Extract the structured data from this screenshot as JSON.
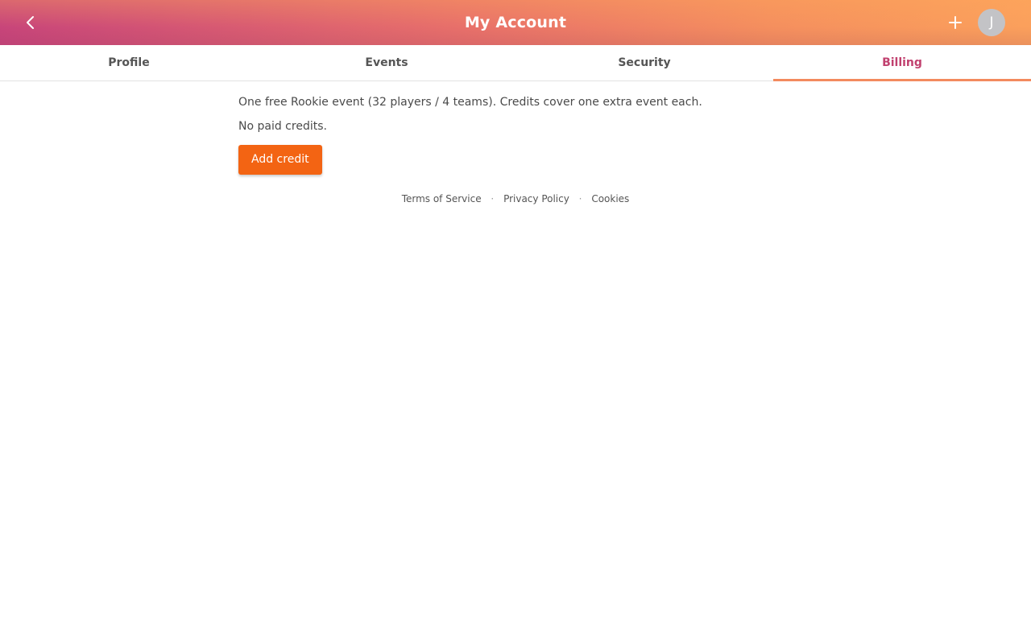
{
  "header": {
    "title": "My Account",
    "avatar_initial": "J",
    "back_icon": "chevron-left-icon",
    "add_icon": "plus-icon",
    "gradient_colors": [
      "#c8457a",
      "#e8706a",
      "#fba05c"
    ]
  },
  "tabs": [
    {
      "label": "Profile",
      "active": false
    },
    {
      "label": "Events",
      "active": false
    },
    {
      "label": "Security",
      "active": false
    },
    {
      "label": "Billing",
      "active": true
    }
  ],
  "billing": {
    "info_text": "One free Rookie event (32 players / 4 teams). Credits cover one extra event each.",
    "credits_text": "No paid credits.",
    "add_credit_label": "Add credit",
    "button_color": "#f36413",
    "active_tab_color": "#c1416f"
  },
  "footer": {
    "links": [
      "Terms of Service",
      "Privacy Policy",
      "Cookies"
    ],
    "separator": "·"
  }
}
